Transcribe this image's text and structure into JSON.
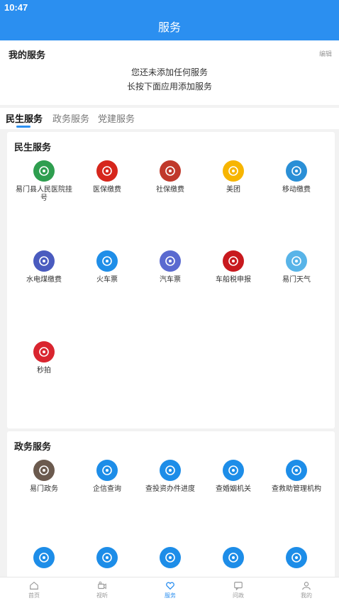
{
  "status": {
    "time": "10:47"
  },
  "header": {
    "title": "服务"
  },
  "my_service": {
    "title": "我的服务",
    "edit_label": "编辑",
    "empty_line1": "您还未添加任何服务",
    "empty_line2": "长按下面应用添加服务"
  },
  "tabs": [
    {
      "label": "民生服务",
      "active": true
    },
    {
      "label": "政务服务",
      "active": false
    },
    {
      "label": "党建服务",
      "active": false
    }
  ],
  "livelihood": {
    "title": "民生服务",
    "items": [
      {
        "label": "易门县人民医院挂号",
        "icon": "hospital-icon",
        "color": "#2e9e4f"
      },
      {
        "label": "医保缴费",
        "icon": "medical-insurance-icon",
        "color": "#d6261c"
      },
      {
        "label": "社保缴费",
        "icon": "social-security-icon",
        "color": "#c0392b"
      },
      {
        "label": "美团",
        "icon": "meituan-icon",
        "color": "#f7b500"
      },
      {
        "label": "移动缴费",
        "icon": "china-mobile-icon",
        "color": "#2a8fd6"
      },
      {
        "label": "水电煤缴费",
        "icon": "utilities-icon",
        "color": "#4a5bbf"
      },
      {
        "label": "火车票",
        "icon": "train-icon",
        "color": "#1f8ee8"
      },
      {
        "label": "汽车票",
        "icon": "bus-icon",
        "color": "#5a6ad0"
      },
      {
        "label": "车船税申报",
        "icon": "vehicle-tax-icon",
        "color": "#c8191e"
      },
      {
        "label": "易门天气",
        "icon": "weather-icon",
        "color": "#58b4e8"
      },
      {
        "label": "秒拍",
        "icon": "miaopai-icon",
        "color": "#d9252f"
      }
    ]
  },
  "government": {
    "title": "政务服务",
    "items": [
      {
        "label": "易门政务",
        "icon": "government-building-icon",
        "color": "#6b5a4e"
      },
      {
        "label": "企信查询",
        "icon": "credit-query-icon",
        "color": "#1d8de8"
      },
      {
        "label": "查投资办件进度",
        "icon": "investment-progress-icon",
        "color": "#1d8de8"
      },
      {
        "label": "查婚姻机关",
        "icon": "marriage-registry-icon",
        "color": "#1d8de8"
      },
      {
        "label": "查救助管理机构",
        "icon": "relief-agency-icon",
        "color": "#1d8de8"
      },
      {
        "label": "",
        "icon": "social-security-query-icon",
        "color": "#1d8de8"
      },
      {
        "label": "",
        "icon": "check-badge-icon",
        "color": "#1d8de8"
      },
      {
        "label": "",
        "icon": "credit-shield-icon",
        "color": "#1d8de8"
      },
      {
        "label": "",
        "icon": "s-service-icon",
        "color": "#1d8de8"
      },
      {
        "label": "",
        "icon": "settings-gear-icon",
        "color": "#1d8de8"
      }
    ]
  },
  "bottom_nav": [
    {
      "label": "首页",
      "icon": "home-icon",
      "active": false
    },
    {
      "label": "视听",
      "icon": "video-icon",
      "active": false
    },
    {
      "label": "服务",
      "icon": "heart-service-icon",
      "active": true
    },
    {
      "label": "问政",
      "icon": "message-icon",
      "active": false
    },
    {
      "label": "我的",
      "icon": "user-icon",
      "active": false
    }
  ],
  "colors": {
    "primary": "#2b8ff0",
    "background": "#f2f2f2"
  }
}
